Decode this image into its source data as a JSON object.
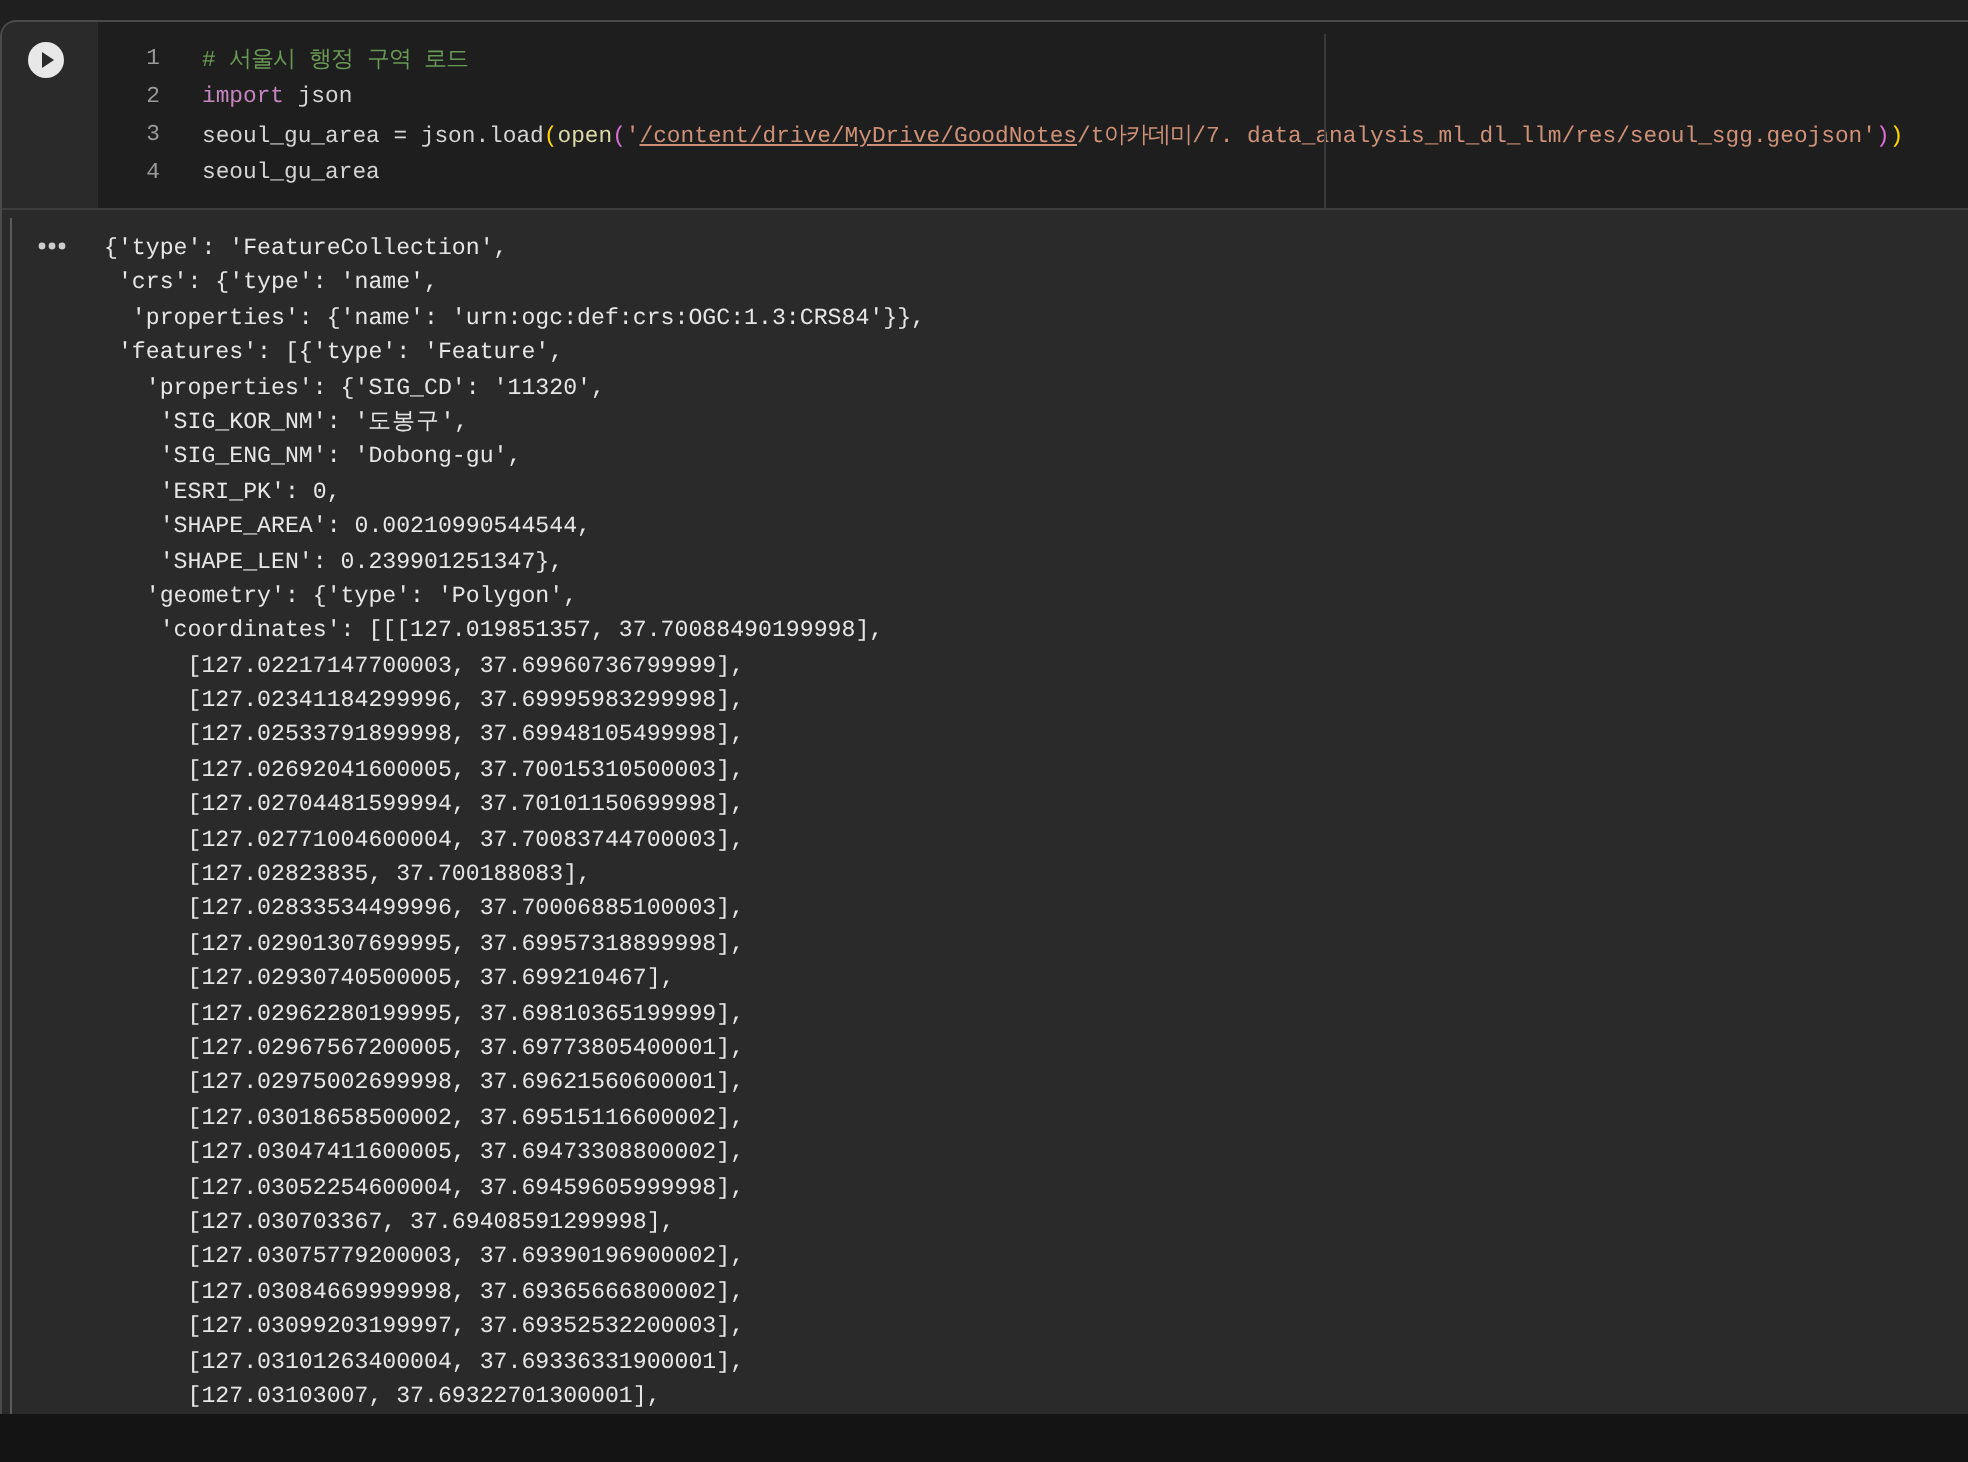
{
  "cell": {
    "code_lines": [
      {
        "number": "1",
        "tokens": [
          {
            "kind": "comment",
            "text": "# 서울시 행정 구역 로드"
          }
        ]
      },
      {
        "number": "2",
        "tokens": [
          {
            "kind": "keyword",
            "text": "import"
          },
          {
            "kind": "text",
            "text": " json"
          }
        ]
      },
      {
        "number": "3",
        "tokens": [
          {
            "kind": "text",
            "text": "seoul_gu_area = json.load"
          },
          {
            "kind": "paren",
            "text": "("
          },
          {
            "kind": "func",
            "text": "open"
          },
          {
            "kind": "paren2",
            "text": "("
          },
          {
            "kind": "string",
            "text": "'"
          },
          {
            "kind": "link",
            "text": "/content/drive/MyDrive/GoodNotes"
          },
          {
            "kind": "string",
            "text": "/t아카데미/7. data_analysis_ml_dl_llm/res/seoul_sgg.geojson'"
          },
          {
            "kind": "paren2",
            "text": ")"
          },
          {
            "kind": "paren",
            "text": ")"
          }
        ]
      },
      {
        "number": "4",
        "tokens": [
          {
            "kind": "text",
            "text": "seoul_gu_area"
          }
        ]
      }
    ]
  },
  "output": {
    "lines": [
      "{'type': 'FeatureCollection',",
      " 'crs': {'type': 'name',",
      "  'properties': {'name': 'urn:ogc:def:crs:OGC:1.3:CRS84'}},",
      " 'features': [{'type': 'Feature',",
      "   'properties': {'SIG_CD': '11320',",
      "    'SIG_KOR_NM': '도봉구',",
      "    'SIG_ENG_NM': 'Dobong-gu',",
      "    'ESRI_PK': 0,",
      "    'SHAPE_AREA': 0.00210990544544,",
      "    'SHAPE_LEN': 0.239901251347},",
      "   'geometry': {'type': 'Polygon',",
      "    'coordinates': [[[127.019851357, 37.70088490199998],",
      "      [127.02217147700003, 37.69960736799999],",
      "      [127.02341184299996, 37.69995983299998],",
      "      [127.02533791899998, 37.69948105499998],",
      "      [127.02692041600005, 37.70015310500003],",
      "      [127.02704481599994, 37.70101150699998],",
      "      [127.02771004600004, 37.70083744700003],",
      "      [127.02823835, 37.700188083],",
      "      [127.02833534499996, 37.70006885100003],",
      "      [127.02901307699995, 37.69957318899998],",
      "      [127.02930740500005, 37.699210467],",
      "      [127.02962280199995, 37.69810365199999],",
      "      [127.02967567200005, 37.69773805400001],",
      "      [127.02975002699998, 37.69621560600001],",
      "      [127.03018658500002, 37.69515116600002],",
      "      [127.03047411600005, 37.69473308800002],",
      "      [127.03052254600004, 37.69459605999998],",
      "      [127.030703367, 37.69408591299998],",
      "      [127.03075779200003, 37.69390196900002],",
      "      [127.03084669999998, 37.69365666800002],",
      "      [127.03099203199997, 37.69352532200003],",
      "      [127.03101263400004, 37.69336331900001],",
      "      [127.03103007, 37.69322701300001],"
    ]
  }
}
